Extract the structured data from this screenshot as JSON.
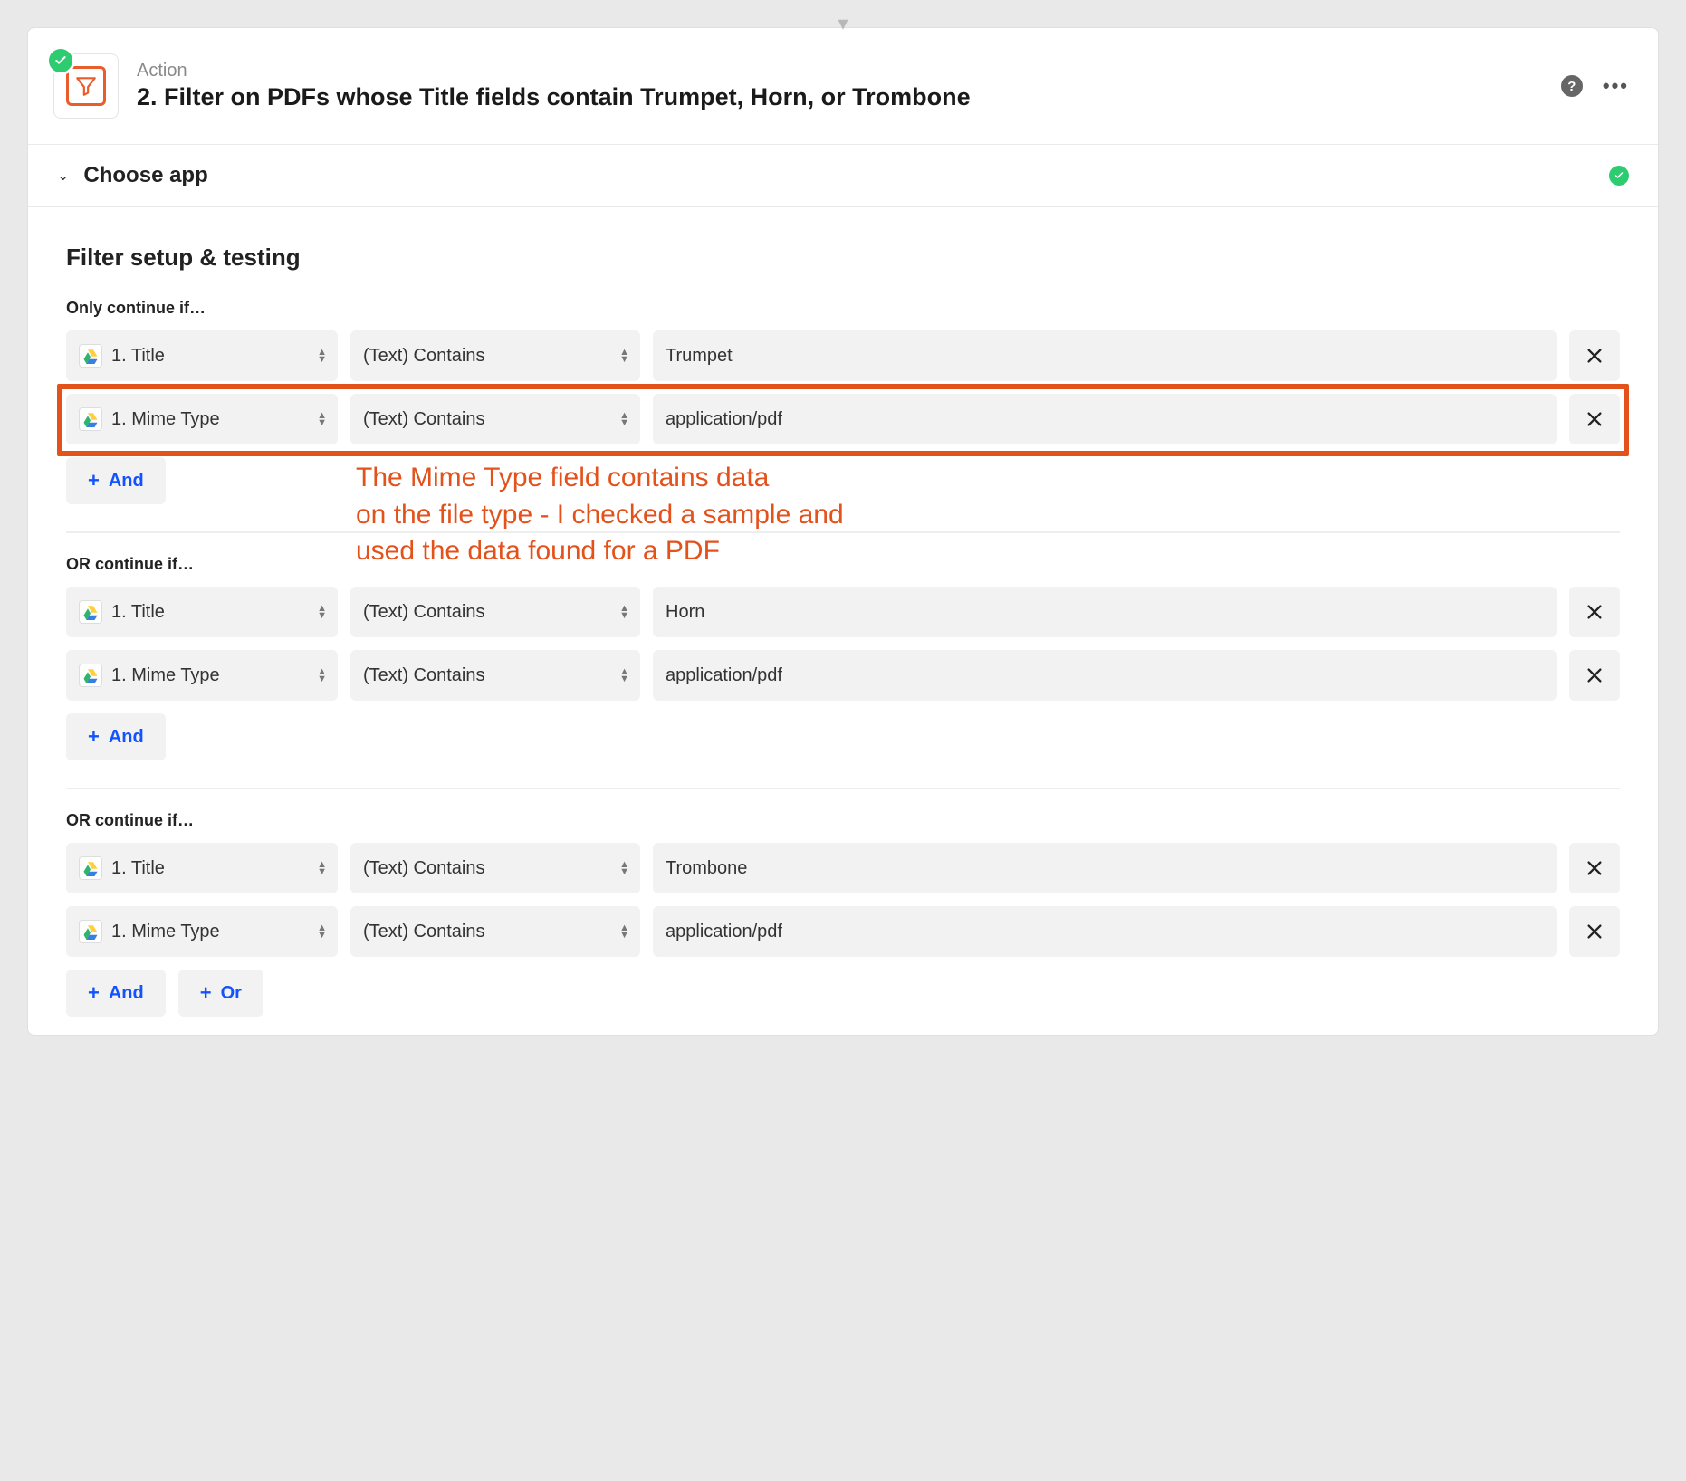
{
  "header": {
    "label": "Action",
    "title": "2. Filter on PDFs whose Title fields contain Trumpet, Horn, or Trombone"
  },
  "section": {
    "choose_app": "Choose app"
  },
  "body_title": "Filter setup & testing",
  "labels": {
    "only_continue": "Only continue if…",
    "or_continue": "OR continue if…",
    "and": "And",
    "or": "Or"
  },
  "groups": [
    {
      "label_key": "only_continue",
      "rules": [
        {
          "field": "1. Title",
          "op": "(Text) Contains",
          "value": "Trumpet"
        },
        {
          "field": "1. Mime Type",
          "op": "(Text) Contains",
          "value": "application/pdf"
        }
      ],
      "buttons": [
        "and"
      ]
    },
    {
      "label_key": "or_continue",
      "rules": [
        {
          "field": "1. Title",
          "op": "(Text) Contains",
          "value": "Horn"
        },
        {
          "field": "1. Mime Type",
          "op": "(Text) Contains",
          "value": "application/pdf"
        }
      ],
      "buttons": [
        "and"
      ]
    },
    {
      "label_key": "or_continue",
      "rules": [
        {
          "field": "1. Title",
          "op": "(Text) Contains",
          "value": "Trombone"
        },
        {
          "field": "1. Mime Type",
          "op": "(Text) Contains",
          "value": "application/pdf"
        }
      ],
      "buttons": [
        "and",
        "or"
      ]
    }
  ],
  "annotation": {
    "line1": "The Mime Type field contains data",
    "line2": "on the file type - I checked a sample and",
    "line3": "used the data found for a PDF"
  }
}
